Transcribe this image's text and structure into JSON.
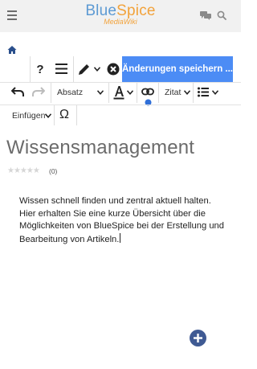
{
  "header": {
    "logo_main_part1": "Blue",
    "logo_main_part2": "Spice",
    "logo_sub": "MediaWiki"
  },
  "editor_toolbar": {
    "save_label": "Änderungen speichern ...",
    "format_label": "Absatz",
    "quote_label": "Zitat",
    "insert_label": "Einfügen",
    "special_char": "Ω"
  },
  "page": {
    "title": "Wissensmanagement",
    "rating_stars": "★★★★★",
    "rating_count": "(0)",
    "content_text": "Wissen schnell finden und zentral aktuell halten. Hier erhalten Sie eine kurze Übersicht über die Möglichkeiten von BlueSpice bei der Erstellung und Bearbeitung von Artikeln."
  },
  "colors": {
    "accent": "#4c8cf5",
    "logo_blue": "#5d9ad3",
    "logo_orange": "#f2a23a",
    "fab": "#3f5a93"
  }
}
